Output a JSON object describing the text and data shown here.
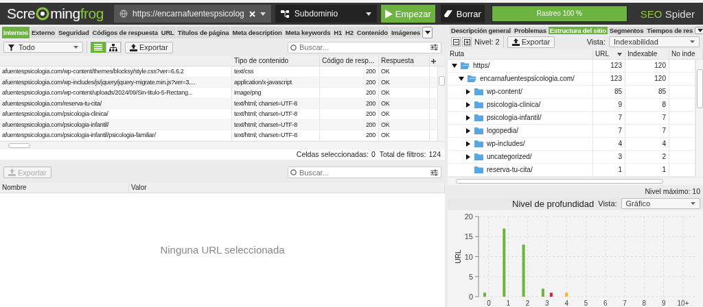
{
  "header": {
    "logo": {
      "part_1": "Scre",
      "part_2": "ming",
      "part_3": "frog"
    },
    "url_field": {
      "value": "https://encarnafuentespsicolog"
    },
    "mode_dropdown": {
      "value": "Subdominio"
    },
    "start_button": "Empezar",
    "clear_button": "Borrar",
    "progress": {
      "label": "Rastreo 100 %",
      "level": 1
    },
    "product": {
      "part_1": "SEO",
      "part_2": "Spider"
    }
  },
  "left_tabs": [
    {
      "label": "Internos",
      "selected": true
    },
    {
      "label": "Externo",
      "selected": false
    },
    {
      "label": "Seguridad",
      "selected": false
    },
    {
      "label": "Códigos de respuesta",
      "selected": false
    },
    {
      "label": "URL",
      "selected": false
    },
    {
      "label": "Títulos de página",
      "selected": false
    },
    {
      "label": "Meta description",
      "selected": false
    },
    {
      "label": "Meta keywords",
      "selected": false
    },
    {
      "label": "H1",
      "selected": false
    },
    {
      "label": "H2",
      "selected": false
    },
    {
      "label": "Contenido",
      "selected": false
    },
    {
      "label": "Imágenes",
      "selected": false
    }
  ],
  "left_toolbar": {
    "filter": "Todo",
    "views": [
      {
        "kind": "list",
        "selected": true
      },
      {
        "kind": "tree",
        "selected": false
      }
    ],
    "export": "Exportar",
    "search_placeholder": "Buscar..."
  },
  "url_table": {
    "columns": [
      "Tipo de contenido",
      "Código de resp...",
      "Respuesta"
    ],
    "rows": [
      {
        "url": "afuentespsicologia.com/wp-content/themes/blocksy/style.css?ver=6.6.2",
        "type": "text/css",
        "code": "200",
        "response": "OK"
      },
      {
        "url": "afuentespsicologia.com/wp-includes/js/jquery/jquery-migrate.min.js?ver=3....",
        "type": "application/x-javascript",
        "code": "200",
        "response": "OK"
      },
      {
        "url": "afuentespsicologia.com/wp-content/uploads/2024/09/Sin-titulo-5-Rectang...",
        "type": "image/png",
        "code": "200",
        "response": "OK"
      },
      {
        "url": "afuentespsicologia.com/reserva-tu-cita/",
        "type": "text/html; charset=UTF-8",
        "code": "200",
        "response": "OK"
      },
      {
        "url": "afuentespsicologia.com/psicologia-clinica/",
        "type": "text/html; charset=UTF-8",
        "code": "200",
        "response": "OK"
      },
      {
        "url": "afuentespsicologia.com/psicologia-infantil/",
        "type": "text/html; charset=UTF-8",
        "code": "200",
        "response": "OK"
      },
      {
        "url": "afuentespsicologia.com/psicologia-infantil/psicologia-familiar/",
        "type": "text/html; charset=UTF-8",
        "code": "200",
        "response": "OK"
      }
    ],
    "status": {
      "selected_label": "Celdas seleccionadas:",
      "selected_value": "0",
      "total_label": "Total de filtros:",
      "total_value": "124"
    }
  },
  "details": {
    "export": "Exportar",
    "export_disabled": true,
    "search_placeholder": "Buscar...",
    "columns": [
      "Nombre",
      "Valor"
    ],
    "empty_message": "Ninguna URL seleccionada"
  },
  "right_tabs": [
    {
      "label": "Descripción general",
      "selected": false
    },
    {
      "label": "Problemas",
      "selected": false
    },
    {
      "label": "Estructura del sitio",
      "selected": true
    },
    {
      "label": "Segmentos",
      "selected": false
    },
    {
      "label": "Tiempos de res",
      "selected": false
    }
  ],
  "right_toolbar": {
    "level_label": "Nivel: 2",
    "export": "Exportar",
    "view_label": "Vista:",
    "view_value": "Indexabilidad"
  },
  "tree_table": {
    "columns": [
      "Ruta",
      "URL",
      "Indexable",
      "No inde"
    ],
    "rows": [
      {
        "name": "https/",
        "url": "123",
        "indexable": "120",
        "expandable": true,
        "expanded": true,
        "children": [
          {
            "name": "encarnafuentespsicologia.com/",
            "url": "123",
            "indexable": "120",
            "expandable": true,
            "expanded": true,
            "children": [
              {
                "name": "wp-content/",
                "url": "85",
                "indexable": "85",
                "expandable": true,
                "expanded": false
              },
              {
                "name": "psicologia-clinica/",
                "url": "9",
                "indexable": "8",
                "expandable": true,
                "expanded": false
              },
              {
                "name": "psicologia-infantil/",
                "url": "7",
                "indexable": "7",
                "expandable": true,
                "expanded": false
              },
              {
                "name": "logopedia/",
                "url": "7",
                "indexable": "7",
                "expandable": true,
                "expanded": false
              },
              {
                "name": "wp-includes/",
                "url": "4",
                "indexable": "4",
                "expandable": true,
                "expanded": false
              },
              {
                "name": "uncategorized/",
                "url": "3",
                "indexable": "2",
                "expandable": true,
                "expanded": false
              },
              {
                "name": "reserva-tu-cita/",
                "url": "1",
                "indexable": "1",
                "expandable": false,
                "expanded": false
              }
            ]
          }
        ]
      }
    ],
    "max_level": "Nivel máximo: 10"
  },
  "depth_panel": {
    "title": "Nivel de profundidad",
    "view_label": "Vista:",
    "view_value": "Gráfico",
    "chart_data": {
      "type": "bar",
      "ylabel": "URL",
      "categories": [
        "0",
        "1",
        "2",
        "3",
        "4",
        "5",
        "6",
        "7",
        "8",
        "9",
        "10+"
      ],
      "series": [
        {
          "color": "#6db33f",
          "values": [
            1,
            17,
            13,
            2,
            null,
            null,
            null,
            null,
            null,
            null,
            null
          ]
        },
        {
          "color": "#f5b530",
          "values": [
            null,
            null,
            null,
            null,
            1,
            null,
            null,
            null,
            null,
            null,
            null
          ]
        },
        {
          "color": "#d9262c",
          "values": [
            null,
            null,
            null,
            1,
            null,
            null,
            null,
            null,
            null,
            null,
            null
          ]
        }
      ],
      "ylim": [
        0,
        20
      ],
      "yticks": [
        0,
        5,
        10,
        15,
        20
      ],
      "grid": true
    }
  }
}
